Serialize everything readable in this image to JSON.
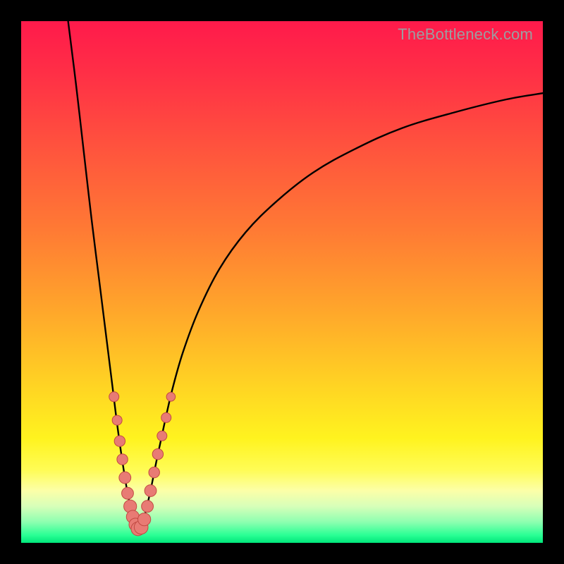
{
  "watermark": "TheBottleneck.com",
  "colors": {
    "frame": "#000000",
    "curve": "#000000",
    "dot_fill": "#e87b74",
    "dot_stroke": "#c24a42",
    "gradient_stops": [
      {
        "offset": 0.0,
        "color": "#ff1a4b"
      },
      {
        "offset": 0.1,
        "color": "#ff2f46"
      },
      {
        "offset": 0.25,
        "color": "#ff553d"
      },
      {
        "offset": 0.4,
        "color": "#ff7a34"
      },
      {
        "offset": 0.55,
        "color": "#ffa52b"
      },
      {
        "offset": 0.7,
        "color": "#ffd423"
      },
      {
        "offset": 0.8,
        "color": "#fff31f"
      },
      {
        "offset": 0.86,
        "color": "#fffc55"
      },
      {
        "offset": 0.9,
        "color": "#fcffa8"
      },
      {
        "offset": 0.93,
        "color": "#d7ffb9"
      },
      {
        "offset": 0.96,
        "color": "#8dffb0"
      },
      {
        "offset": 0.985,
        "color": "#2bff95"
      },
      {
        "offset": 1.0,
        "color": "#00e67a"
      }
    ]
  },
  "chart_data": {
    "type": "line",
    "title": "",
    "xlabel": "",
    "ylabel": "",
    "x_range_pct": [
      0,
      100
    ],
    "y_range_pct": [
      0,
      100
    ],
    "note": "Values are approximate normalized percentages read from pixel positions; x increases to the right, y = 0 at top. Curve resembles a bottleneck V-shape with minimum near x≈22%.",
    "series": [
      {
        "name": "bottleneck-curve",
        "points_pct": [
          {
            "x": 9.0,
            "y": 0.0
          },
          {
            "x": 10.5,
            "y": 12.0
          },
          {
            "x": 12.0,
            "y": 25.0
          },
          {
            "x": 13.5,
            "y": 38.0
          },
          {
            "x": 15.0,
            "y": 50.0
          },
          {
            "x": 16.5,
            "y": 62.0
          },
          {
            "x": 17.5,
            "y": 70.0
          },
          {
            "x": 18.5,
            "y": 78.0
          },
          {
            "x": 19.5,
            "y": 85.0
          },
          {
            "x": 20.5,
            "y": 91.0
          },
          {
            "x": 21.5,
            "y": 95.5
          },
          {
            "x": 22.3,
            "y": 97.5
          },
          {
            "x": 23.0,
            "y": 97.0
          },
          {
            "x": 24.0,
            "y": 93.5
          },
          {
            "x": 25.0,
            "y": 89.0
          },
          {
            "x": 26.0,
            "y": 84.0
          },
          {
            "x": 27.5,
            "y": 77.0
          },
          {
            "x": 29.0,
            "y": 70.5
          },
          {
            "x": 31.0,
            "y": 63.5
          },
          {
            "x": 34.0,
            "y": 55.5
          },
          {
            "x": 38.0,
            "y": 47.5
          },
          {
            "x": 43.0,
            "y": 40.5
          },
          {
            "x": 49.0,
            "y": 34.5
          },
          {
            "x": 56.0,
            "y": 29.0
          },
          {
            "x": 64.0,
            "y": 24.5
          },
          {
            "x": 73.0,
            "y": 20.5
          },
          {
            "x": 83.0,
            "y": 17.5
          },
          {
            "x": 93.0,
            "y": 15.0
          },
          {
            "x": 100.0,
            "y": 13.8
          }
        ]
      }
    ],
    "scatter": {
      "name": "highlighted-points",
      "points_pct": [
        {
          "x": 17.8,
          "y": 72.0,
          "r": 1.0
        },
        {
          "x": 18.4,
          "y": 76.5,
          "r": 1.0
        },
        {
          "x": 18.9,
          "y": 80.5,
          "r": 1.1
        },
        {
          "x": 19.4,
          "y": 84.0,
          "r": 1.1
        },
        {
          "x": 19.9,
          "y": 87.5,
          "r": 1.2
        },
        {
          "x": 20.4,
          "y": 90.5,
          "r": 1.2
        },
        {
          "x": 20.9,
          "y": 93.0,
          "r": 1.3
        },
        {
          "x": 21.4,
          "y": 95.0,
          "r": 1.3
        },
        {
          "x": 21.9,
          "y": 96.5,
          "r": 1.3
        },
        {
          "x": 22.4,
          "y": 97.3,
          "r": 1.4
        },
        {
          "x": 23.0,
          "y": 97.0,
          "r": 1.4
        },
        {
          "x": 23.6,
          "y": 95.5,
          "r": 1.3
        },
        {
          "x": 24.2,
          "y": 93.0,
          "r": 1.2
        },
        {
          "x": 24.8,
          "y": 90.0,
          "r": 1.2
        },
        {
          "x": 25.5,
          "y": 86.5,
          "r": 1.1
        },
        {
          "x": 26.2,
          "y": 83.0,
          "r": 1.1
        },
        {
          "x": 27.0,
          "y": 79.5,
          "r": 1.0
        },
        {
          "x": 27.8,
          "y": 76.0,
          "r": 1.0
        },
        {
          "x": 28.7,
          "y": 72.0,
          "r": 0.9
        }
      ]
    }
  }
}
